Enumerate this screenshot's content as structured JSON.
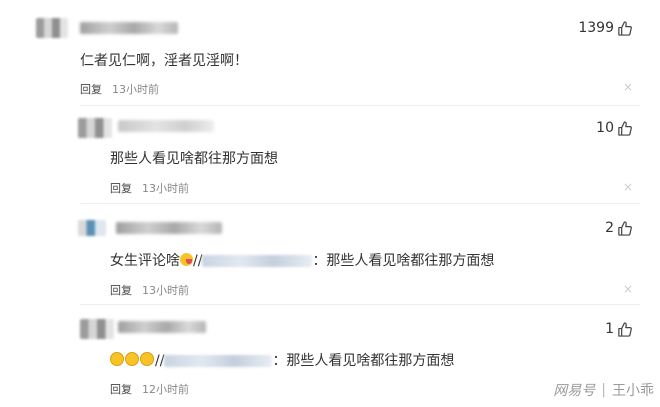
{
  "comments": [
    {
      "text": "仁者见仁啊，淫者见淫啊！",
      "reply_label": "回复",
      "time": "13小时前",
      "likes": "1399",
      "close_glyph": "×"
    },
    {
      "text": "那些人看见啥都往那方面想",
      "reply_label": "回复",
      "time": "13小时前",
      "likes": "10",
      "close_glyph": "×"
    },
    {
      "text_prefix": "女生评论啥",
      "text_sep": "//",
      "text_suffix": "：那些人看见啥都往那方面想",
      "reply_label": "回复",
      "time": "13小时前",
      "likes": "2",
      "close_glyph": "×"
    },
    {
      "text_sep": "//",
      "text_suffix": "：那些人看见啥都往那方面想",
      "reply_label": "回复",
      "time": "12小时前",
      "likes": "1",
      "close_glyph": "×"
    }
  ],
  "watermark": {
    "brand": "网易号",
    "separator": "|",
    "author": "王小乖"
  },
  "icons": {
    "like": "thumbs-up-icon",
    "close": "close-icon"
  }
}
